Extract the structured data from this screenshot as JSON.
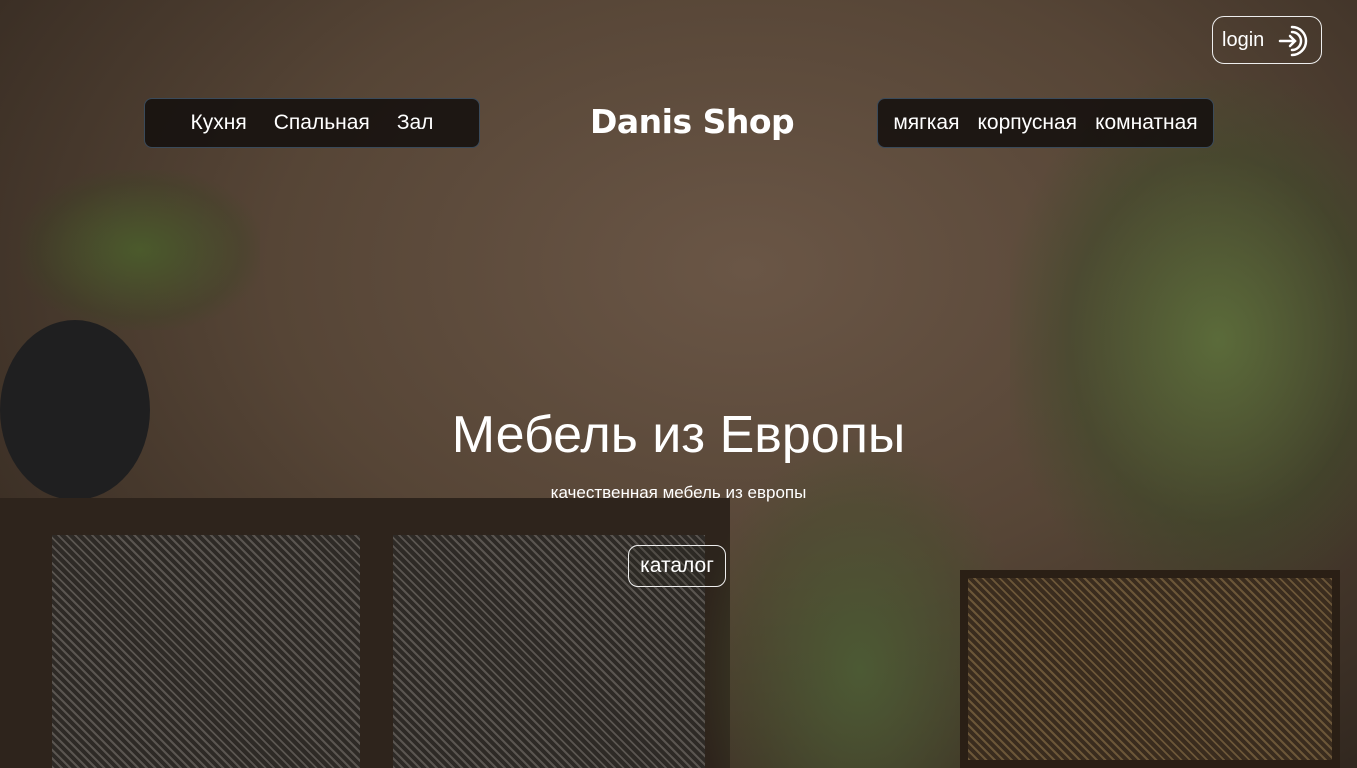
{
  "header": {
    "logo": "Danis Shop",
    "login_label": "login",
    "nav_left": [
      {
        "label": "Кухня"
      },
      {
        "label": "Спальная"
      },
      {
        "label": "Зал"
      }
    ],
    "nav_right": [
      {
        "label": "мягкая"
      },
      {
        "label": "корпусная"
      },
      {
        "label": "комнатная"
      }
    ]
  },
  "hero": {
    "title": "Мебель из Европы",
    "subtitle": "качественная мебель из европы",
    "button_label": "каталог"
  }
}
